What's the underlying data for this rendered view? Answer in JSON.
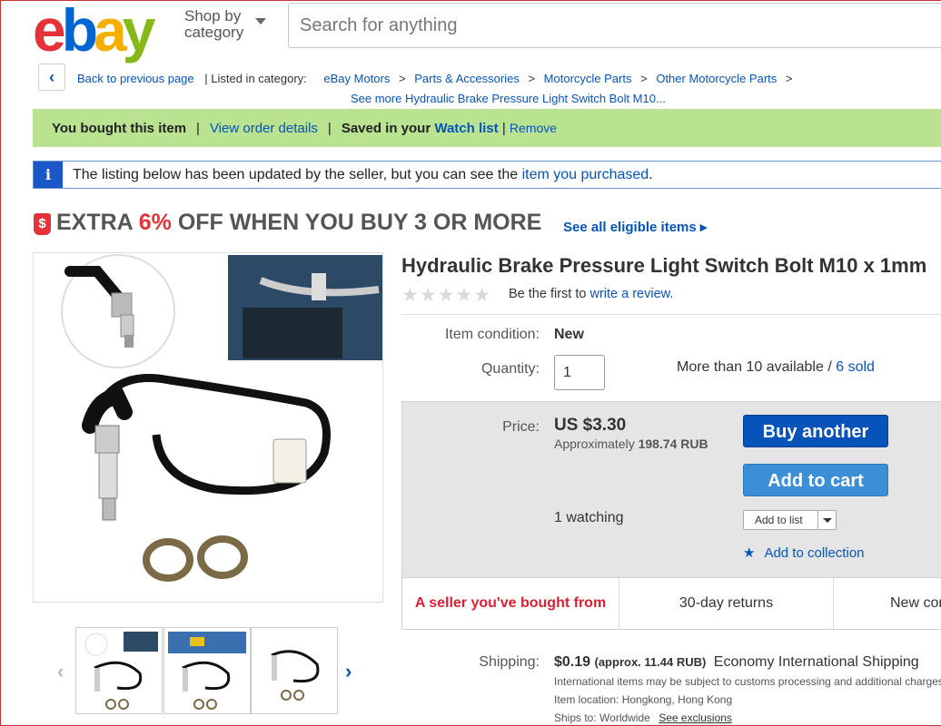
{
  "header": {
    "logo": {
      "e": "e",
      "b": "b",
      "a": "a",
      "y": "y"
    },
    "shop_by_line1": "Shop by",
    "shop_by_line2": "category",
    "search_placeholder": "Search for anything"
  },
  "breadcrumb": {
    "back": "Back to previous page",
    "listed_in": "| Listed in category:",
    "items": [
      "eBay Motors",
      "Parts & Accessories",
      "Motorcycle Parts",
      "Other Motorcycle Parts"
    ],
    "sep": ">",
    "see_more": "See more Hydraulic Brake Pressure Light Switch Bolt M10..."
  },
  "status_bar": {
    "bought": "You bought this item",
    "sep": "|",
    "view_order": "View order details",
    "saved": "Saved in your",
    "watch_list": "Watch list",
    "remove": "Remove"
  },
  "info_bar": {
    "icon": "i",
    "text": "The listing below has been updated by the seller, but you can see the",
    "link": "item you purchased",
    "period": "."
  },
  "promo": {
    "icon": "$",
    "pre": "EXTRA ",
    "pct": "6%",
    "post": " OFF WHEN YOU BUY 3 OR MORE",
    "link": "See all eligible items ▸"
  },
  "item": {
    "title": "Hydraulic Brake Pressure Light Switch Bolt M10 x 1mm",
    "stars": "★★★★★",
    "rating_text": "Be the first to",
    "rating_link": "write a review.",
    "condition_label": "Item condition:",
    "condition_value": "New",
    "quantity_label": "Quantity:",
    "quantity_value": "1",
    "availability": "More than 10 available /",
    "sold": "6 sold"
  },
  "price": {
    "label": "Price:",
    "value": "US $3.30",
    "approx_label": "Approximately",
    "approx_value": "198.74 RUB",
    "watching": "1 watching",
    "buy_another": "Buy another",
    "add_to_cart": "Add to cart",
    "add_to_list": "Add to list",
    "add_to_collection": "Add to collection"
  },
  "features": [
    "A seller you've bought from",
    "30-day returns",
    "New condition"
  ],
  "shipping": {
    "label": "Shipping:",
    "cost": "$0.19",
    "approx": "(approx. 11.44 RUB)",
    "service": "Economy International Shipping",
    "note": "International items may be subject to customs processing and additional charges.",
    "location_label": "Item location:",
    "location": "Hongkong, Hong Kong",
    "ships_label": "Ships to:",
    "ships": "Worldwide",
    "exclusions": "See exclusions"
  },
  "colors": {
    "green_bar": "#b9e291",
    "link": "#0654ba",
    "buy_button": "#0654ba",
    "cart_button": "#3b8fd6",
    "promo_red": "#e53238"
  }
}
